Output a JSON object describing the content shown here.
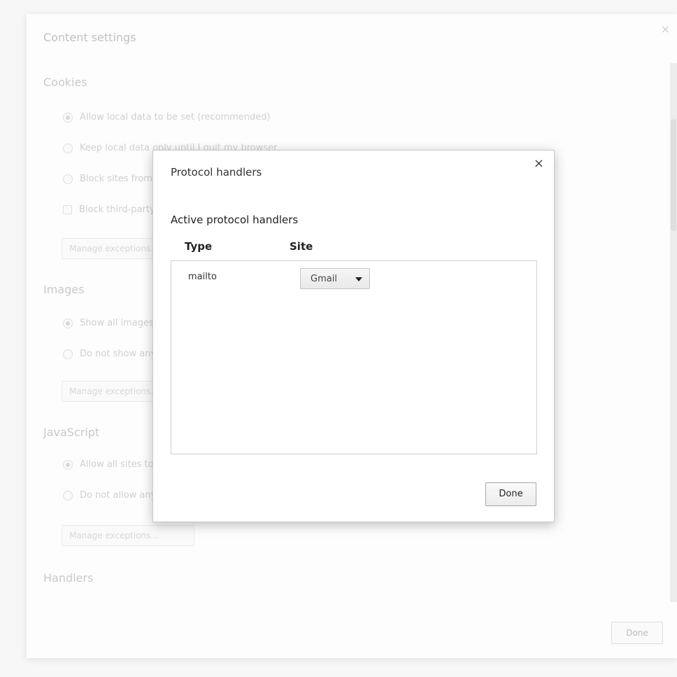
{
  "content_settings": {
    "title": "Content settings",
    "close_glyph": "×",
    "done_label": "Done",
    "sections": {
      "cookies": {
        "heading": "Cookies",
        "options": [
          {
            "label": "Allow local data to be set (recommended)",
            "selected": true,
            "kind": "radio"
          },
          {
            "label": "Keep local data only until I quit my browser",
            "selected": false,
            "kind": "radio"
          },
          {
            "label": "Block sites from setting any data",
            "selected": false,
            "kind": "radio"
          },
          {
            "label": "Block third-party cookies and site data",
            "selected": false,
            "kind": "checkbox"
          }
        ],
        "manage_label": "Manage exceptions..."
      },
      "images": {
        "heading": "Images",
        "options": [
          {
            "label": "Show all images (recommended)",
            "selected": true,
            "kind": "radio"
          },
          {
            "label": "Do not show any images",
            "selected": false,
            "kind": "radio"
          }
        ],
        "manage_label": "Manage exceptions..."
      },
      "javascript": {
        "heading": "JavaScript",
        "options": [
          {
            "label": "Allow all sites to run JavaScript (recommended)",
            "selected": true,
            "kind": "radio"
          },
          {
            "label": "Do not allow any site to run JavaScript",
            "selected": false,
            "kind": "radio"
          }
        ],
        "manage_label": "Manage exceptions..."
      },
      "handlers": {
        "heading": "Handlers"
      }
    }
  },
  "dialog": {
    "title": "Protocol handlers",
    "close_glyph": "×",
    "subtitle": "Active protocol handlers",
    "columns": [
      "Type",
      "Site"
    ],
    "rows": [
      {
        "type": "mailto",
        "site": "Gmail"
      }
    ],
    "done_label": "Done"
  },
  "icons": {
    "close": "close-icon",
    "dropdown": "chevron-down-icon",
    "radio": "radio-icon",
    "checkbox": "checkbox-icon"
  }
}
